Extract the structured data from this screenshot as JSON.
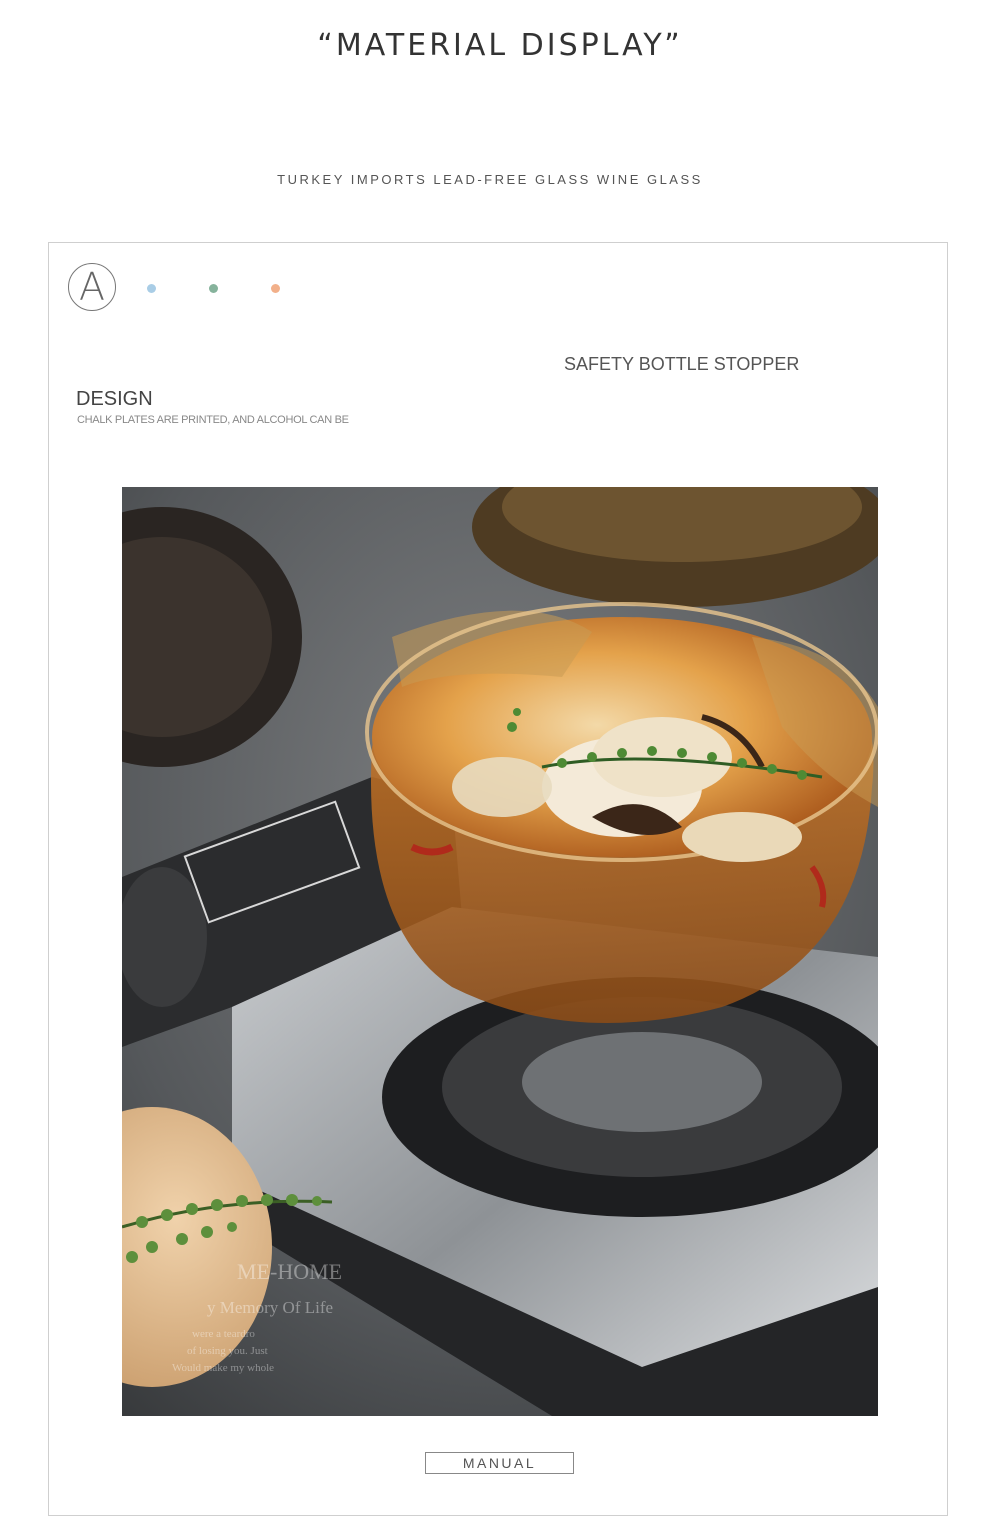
{
  "header": {
    "title": "“MATERIAL DISPLAY”",
    "subtitle": "TURKEY IMPORTS LEAD-FREE GLASS WINE GLASS"
  },
  "panel": {
    "badge_letter": "A",
    "color_dots": [
      "#a9cde6",
      "#86b39c",
      "#f2b08a"
    ],
    "safety_label": "SAFETY BOTTLE STOPPER",
    "design_heading": "DESIGN",
    "design_description": "CHALK PLATES ARE PRINTED, AND ALCOHOL CAN BE",
    "photo": {
      "icon": "glass-pot-soup-on-stove-photo",
      "watermark_lines": [
        "ME-HOME",
        "y  Memory  Of  Life",
        "were a teardro",
        "of losing you. Just",
        "Would make my whole"
      ]
    },
    "manual_button": "MANUAL"
  }
}
